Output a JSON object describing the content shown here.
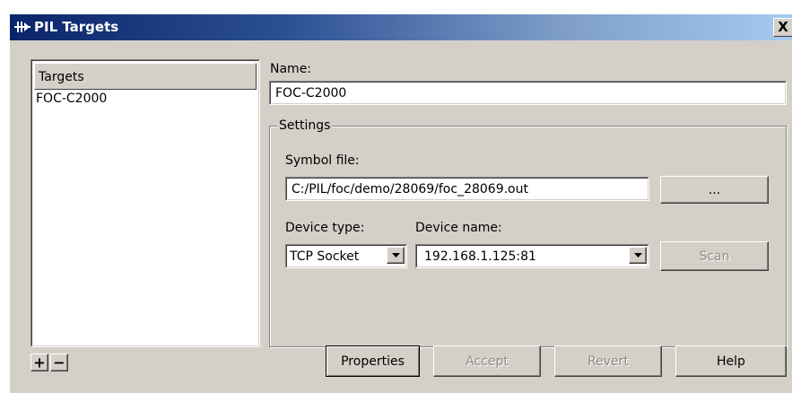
{
  "window": {
    "title": "PIL Targets",
    "close_label": "X"
  },
  "targets_list": {
    "header": "Targets",
    "items": [
      "FOC-C2000"
    ]
  },
  "name": {
    "label": "Name:",
    "value": "FOC-C2000"
  },
  "settings": {
    "legend": "Settings",
    "symbol_file_label": "Symbol file:",
    "symbol_file_value": "C:/PIL/foc/demo/28069/foc_28069.out",
    "browse_label": "...",
    "device_type_label": "Device type:",
    "device_type_value": "TCP Socket",
    "device_name_label": "Device name:",
    "device_name_value": "192.168.1.125:81",
    "scan_label": "Scan"
  },
  "list_controls": {
    "add_label": "+",
    "remove_label": "−"
  },
  "footer": {
    "properties_label": "Properties",
    "accept_label": "Accept",
    "revert_label": "Revert",
    "help_label": "Help"
  },
  "colors": {
    "titlebar_start": "#0a246a",
    "titlebar_end": "#a6caf0",
    "face": "#d4d0c8"
  }
}
